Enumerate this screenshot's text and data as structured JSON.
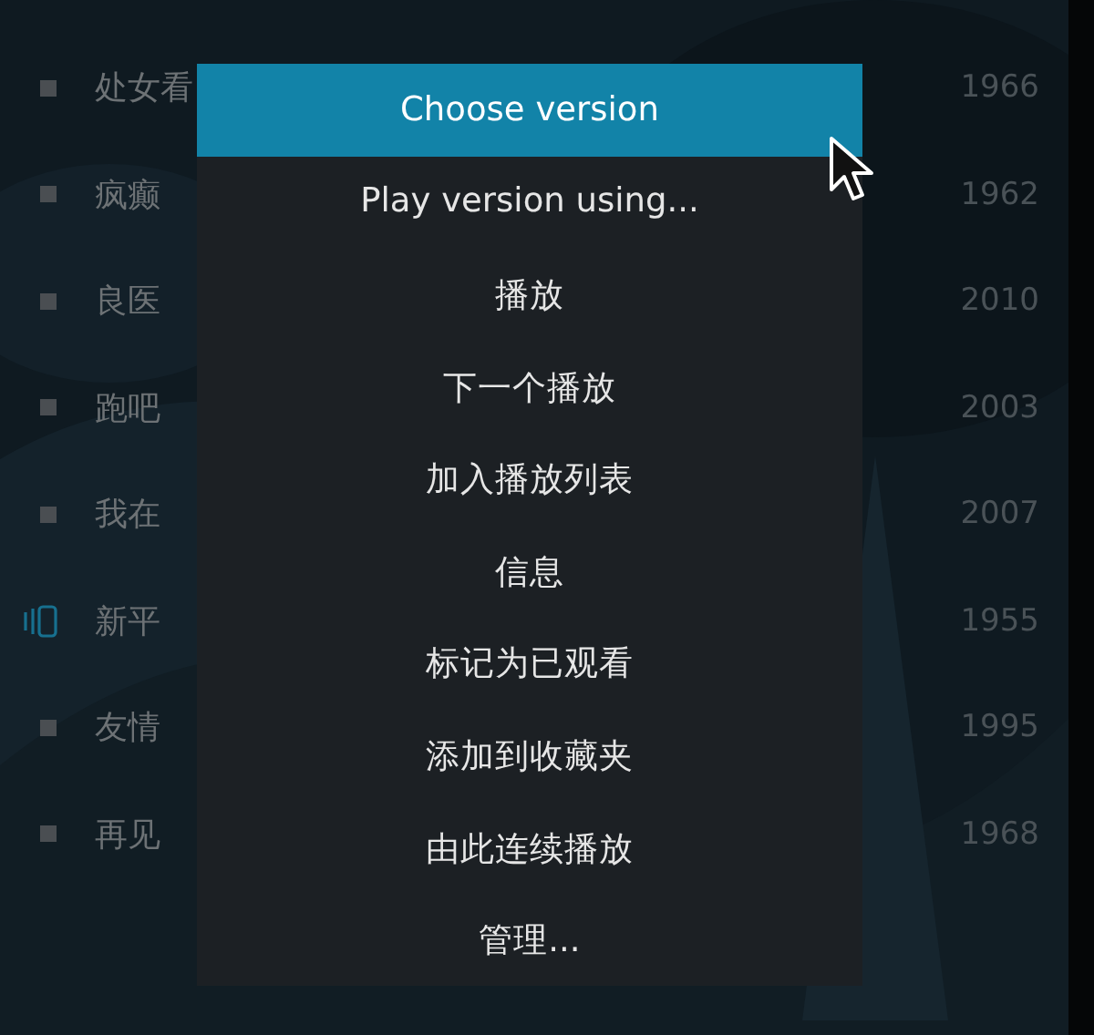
{
  "movie_list": [
    {
      "kind": "bullet",
      "title": "处女看",
      "year": "1966"
    },
    {
      "kind": "bullet",
      "title": "疯癫",
      "year": "1962"
    },
    {
      "kind": "bullet",
      "title": "良医",
      "year": "2010"
    },
    {
      "kind": "bullet",
      "title": "跑吧",
      "year": "2003"
    },
    {
      "kind": "bullet",
      "title": "我在",
      "year": "2007"
    },
    {
      "kind": "playing",
      "title": "新平",
      "year": "1955"
    },
    {
      "kind": "bullet",
      "title": "友情",
      "year": "1995"
    },
    {
      "kind": "bullet",
      "title": "再见",
      "year": "1968"
    }
  ],
  "context_menu": {
    "items": [
      {
        "label": "Choose version",
        "selected": true
      },
      {
        "label": "Play version using...",
        "selected": false
      },
      {
        "label": "播放",
        "selected": false
      },
      {
        "label": "下一个播放",
        "selected": false
      },
      {
        "label": "加入播放列表",
        "selected": false
      },
      {
        "label": "信息",
        "selected": false
      },
      {
        "label": "标记为已观看",
        "selected": false
      },
      {
        "label": "添加到收藏夹",
        "selected": false
      },
      {
        "label": "由此连续播放",
        "selected": false
      },
      {
        "label": "管理...",
        "selected": false
      }
    ]
  }
}
